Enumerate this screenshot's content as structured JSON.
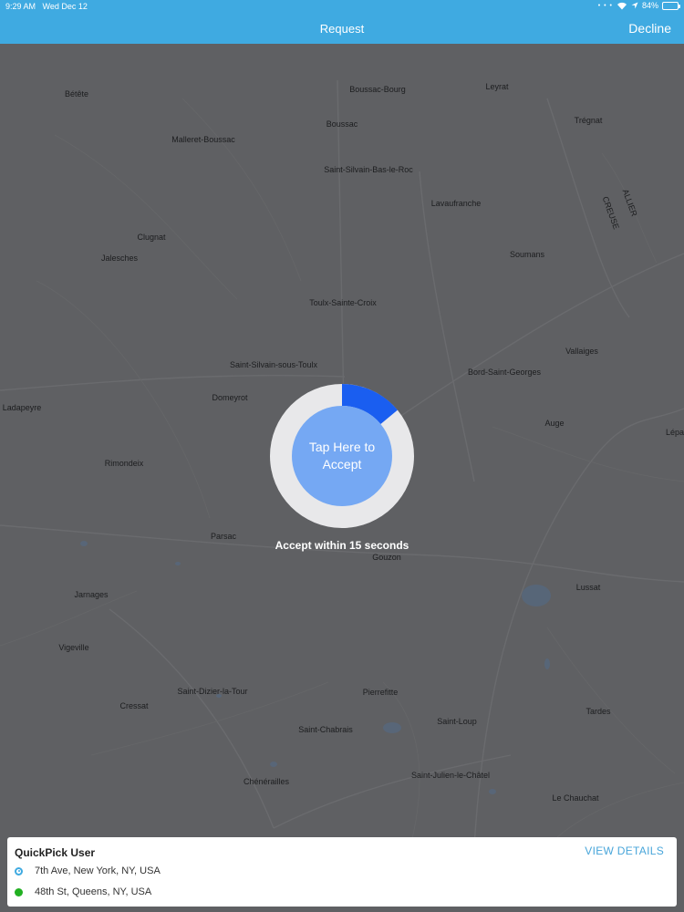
{
  "status_bar": {
    "time": "9:29 AM",
    "date": "Wed Dec 12",
    "battery": "84%"
  },
  "header": {
    "title": "Request",
    "decline_label": "Decline"
  },
  "map": {
    "places": [
      "Bétête",
      "Boussac-Bourg",
      "Leyrat",
      "Boussac",
      "Trégnat",
      "Malleret-Boussac",
      "Saint-Silvain-Bas-le-Roc",
      "Lavaufranche",
      "ALLIER",
      "CREUSE",
      "Clugnat",
      "Jalesches",
      "Soumans",
      "Toulx-Sainte-Croix",
      "Vallaiges",
      "Saint-Silvain-sous-Toulx",
      "Bord-Saint-Georges",
      "Domeyrot",
      "Ladapeyre",
      "Auge",
      "Lépa",
      "Rimondeix",
      "Parsac",
      "Gouzon",
      "Lussat",
      "Jarnages",
      "Vigeville",
      "Pierrefitte",
      "Saint-Dizier-la-Tour",
      "Cressat",
      "Tardes",
      "Saint-Loup",
      "Saint-Chabrais",
      "Saint-Julien-le-Châtel",
      "Le Chauchat",
      "Chénérailles"
    ]
  },
  "accept": {
    "label": "Tap Here to Accept",
    "hint": "Accept within 15 seconds",
    "progress": 0.14,
    "ring_color": "#e8e8ea",
    "progress_color": "#1a5ef0"
  },
  "request_card": {
    "user_name": "QuickPick User",
    "view_details_label": "VIEW DETAILS",
    "pickup_address": "7th Ave, New York, NY, USA",
    "dropoff_address": "48th St, Queens, NY, USA"
  }
}
